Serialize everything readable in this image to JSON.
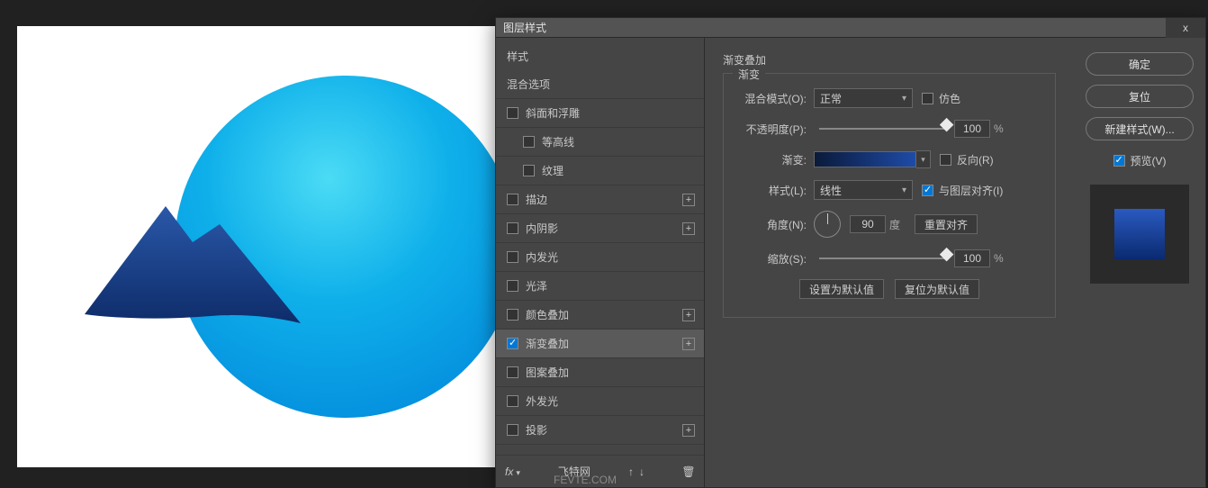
{
  "dialog": {
    "title": "图层样式",
    "close": "x"
  },
  "styles_list": {
    "header_style": "样式",
    "header_blend": "混合选项",
    "bevel": "斜面和浮雕",
    "contour": "等高线",
    "texture": "纹理",
    "stroke": "描边",
    "inner_shadow": "内阴影",
    "inner_glow": "内发光",
    "satin": "光泽",
    "color_overlay": "颜色叠加",
    "gradient_overlay": "渐变叠加",
    "pattern_overlay": "图案叠加",
    "outer_glow": "外发光",
    "drop_shadow": "投影",
    "watermark": "飞特网"
  },
  "settings": {
    "section_title": "渐变叠加",
    "group_label": "渐变",
    "blend_mode_label": "混合模式(O):",
    "blend_mode_value": "正常",
    "dither_label": "仿色",
    "opacity_label": "不透明度(P):",
    "opacity_value": "100",
    "percent": "%",
    "gradient_label": "渐变:",
    "reverse_label": "反向(R)",
    "style_label": "样式(L):",
    "style_value": "线性",
    "align_label": "与图层对齐(I)",
    "angle_label": "角度(N):",
    "angle_value": "90",
    "degree": "度",
    "reset_align": "重置对齐",
    "scale_label": "缩放(S):",
    "scale_value": "100",
    "set_default": "设置为默认值",
    "reset_default": "复位为默认值"
  },
  "actions": {
    "ok": "确定",
    "reset": "复位",
    "new_style": "新建样式(W)...",
    "preview": "预览(V)"
  },
  "footer": {
    "fx": "fx",
    "watermark2": "FEVTE.COM"
  }
}
